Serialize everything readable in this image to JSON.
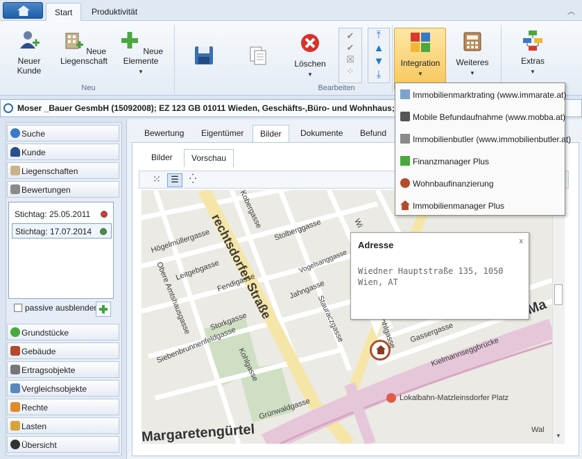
{
  "ribbon_tabs": {
    "start": "Start",
    "produktivitat": "Produktivität"
  },
  "ribbon": {
    "neuer_kunde": "Neuer Kunde",
    "neue_liegenschaft": "Neue Liegenschaft",
    "neue_elemente": "Neue Elemente",
    "group_neu": "Neu",
    "loeschen": "Löschen",
    "group_bearbeiten": "Bearbeiten",
    "integration": "Integration",
    "weiteres": "Weiteres",
    "extras": "Extras"
  },
  "infobar": {
    "text": "Moser _Bauer GesmbH (15092008); EZ 123 GB 01011 Wieden, Geschäfts-,Büro- und Wohnhaus; Bewertung"
  },
  "sidebar": {
    "top_items": [
      "Suche",
      "Kunde",
      "Liegenschaften",
      "Bewertungen"
    ],
    "stichtage": [
      {
        "label": "Stichtag:",
        "date": "25.05.2011",
        "status_color": "#d93a2b"
      },
      {
        "label": "Stichtag:",
        "date": "17.07.2014",
        "status_color": "#3a9a32"
      }
    ],
    "passive_label": "passive ausblenden",
    "bottom_items": [
      "Grundstücke",
      "Gebäude",
      "Ertragsobjekte",
      "Vergleichsobjekte",
      "Rechte",
      "Lasten",
      "Übersicht"
    ]
  },
  "main_tabs": [
    "Bewertung",
    "Eigentümer",
    "Bilder",
    "Dokumente",
    "Befund"
  ],
  "sub_tabs": [
    "Bilder",
    "Vorschau"
  ],
  "map": {
    "labels": {
      "wiedner": "Wiedner Hauptstraße",
      "hoegel": "Högelmüllergasse",
      "kober": "Kobergasse",
      "stolberg": "Stolberggasse",
      "vogelsang": "Vogelsanggasse",
      "leitgeb": "Leitgebgasse",
      "amtshaus": "Obere Amtshausgasse",
      "fendi": "Fendigasse",
      "jahn": "Jahngasse",
      "stauracz": "Stauraczgasse",
      "stork": "Storkgasse",
      "siebenbrunnen": "Siebenbrunnenfeldgasse",
      "kohl": "Kohlgasse",
      "kohl2": "Kohlgasse",
      "gasser": "Gassergasse",
      "kielmann": "Kielmannseggbrücke",
      "gruenwald": "Grünwaldgasse",
      "lokalbahn": "Lokalbahn-Matzleinsdorfer Platz",
      "margareten": "Margaretengürtel",
      "wal": "Wal",
      "ma": "Ma",
      "dorfer": "rechtsdorfer Straße",
      "wi": "Wi"
    },
    "popup": {
      "title": "Adresse",
      "close": "x",
      "address": "Wiedner Hauptstraße 135, 1050 Wien, AT"
    }
  },
  "dropdown": [
    "Immobilienmarktrating (www.immarate.at)",
    "Mobile Befundaufnahme (www.mobba.at)",
    "Immobilienbutler (www.immobilienbutler.at)",
    "Finanzmanager Plus",
    "Wohnbaufinanzierung",
    "Immobilienmanager Plus"
  ]
}
